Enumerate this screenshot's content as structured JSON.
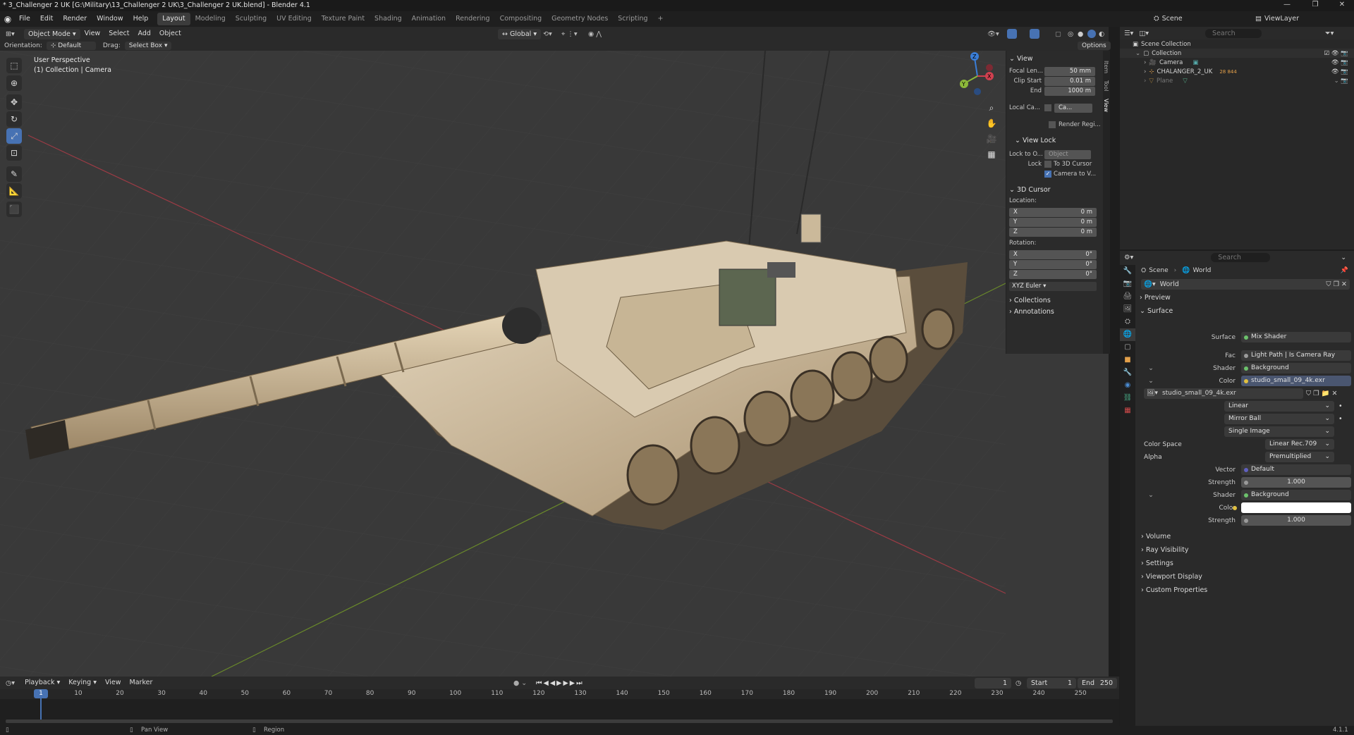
{
  "window": {
    "title": "* 3_Challenger 2 UK [G:\\Military\\13_Challenger 2 UK\\3_Challenger 2 UK.blend] - Blender 4.1",
    "controls": [
      "—",
      "❐",
      "✕"
    ]
  },
  "menu": [
    "File",
    "Edit",
    "Render",
    "Window",
    "Help"
  ],
  "workspaces": [
    "Layout",
    "Modeling",
    "Sculpting",
    "UV Editing",
    "Texture Paint",
    "Shading",
    "Animation",
    "Rendering",
    "Compositing",
    "Geometry Nodes",
    "Scripting"
  ],
  "active_workspace": "Layout",
  "scene_selector": {
    "scene": "Scene",
    "view_layer": "ViewLayer"
  },
  "viewport_header": {
    "mode": "Object Mode",
    "menus": [
      "View",
      "Select",
      "Add",
      "Object"
    ],
    "transform_orientation": "Global",
    "options_label": "Options",
    "orientation_label": "Orientation:",
    "orientation_value": "Default",
    "drag_label": "Drag:",
    "drag_value": "Select Box"
  },
  "viewport": {
    "perspective": "User Perspective",
    "context": "(1) Collection | Camera",
    "gizmo_axes": [
      "X",
      "Y",
      "Z"
    ]
  },
  "npanel": {
    "tabs": [
      "Item",
      "Tool",
      "View"
    ],
    "view_section": "View",
    "focal_length_label": "Focal Len...",
    "focal_length": "50 mm",
    "clip_start_label": "Clip Start",
    "clip_start": "0.01 m",
    "end_label": "End",
    "clip_end": "1000 m",
    "local_camera_label": "Local Ca...",
    "local_camera_value": "Ca...",
    "render_region_label": "Render Regi...",
    "view_lock_section": "View Lock",
    "lock_to_object_label": "Lock to O...",
    "lock_to_object_value": "Object",
    "lock_label": "Lock",
    "to_3d_cursor": "To 3D Cursor",
    "camera_to_view": "Camera to V...",
    "cursor_section": "3D Cursor",
    "location_label": "Location:",
    "loc_x": "0 m",
    "loc_y": "0 m",
    "loc_z": "0 m",
    "rotation_label": "Rotation:",
    "rot_x": "0°",
    "rot_y": "0°",
    "rot_z": "0°",
    "rotation_mode": "XYZ Euler",
    "collections_section": "Collections",
    "annotations_section": "Annotations",
    "axis_x": "X",
    "axis_y": "Y",
    "axis_z": "Z"
  },
  "outliner": {
    "search_placeholder": "Search",
    "root": "Scene Collection",
    "collection": "Collection",
    "items": [
      {
        "name": "Camera",
        "color": "#e3a04a"
      },
      {
        "name": "CHALANGER_2_UK",
        "color": "#e3a04a",
        "badge": "28 844"
      },
      {
        "name": "Plane",
        "color": "#e3a04a"
      }
    ]
  },
  "properties": {
    "search_placeholder": "Search",
    "breadcrumb": [
      "Scene",
      "World"
    ],
    "world_name": "World",
    "sections": {
      "preview": "Preview",
      "surface": "Surface",
      "volume": "Volume",
      "ray_visibility": "Ray Visibility",
      "settings": "Settings",
      "viewport_display": "Viewport Display",
      "custom_properties": "Custom Properties"
    },
    "surface_label": "Surface",
    "surface_value": "Mix Shader",
    "fac_label": "Fac",
    "fac_value": "Light Path | Is Camera Ray",
    "shader1_label": "Shader",
    "shader1_value": "Background",
    "color1_label": "Color",
    "color1_value": "studio_small_09_4k.exr",
    "image_name": "studio_small_09_4k.exr",
    "interp": "Linear",
    "projection": "Mirror Ball",
    "source": "Single Image",
    "color_space_label": "Color Space",
    "color_space_value": "Linear Rec.709",
    "alpha_label": "Alpha",
    "alpha_value": "Premultiplied",
    "vector_label": "Vector",
    "vector_value": "Default",
    "strength1_label": "Strength",
    "strength1_value": "1.000",
    "shader2_label": "Shader",
    "shader2_value": "Background",
    "color2_label": "Color",
    "strength2_label": "Strength",
    "strength2_value": "1.000"
  },
  "timeline": {
    "menus": [
      "Playback",
      "Keying",
      "View",
      "Marker"
    ],
    "current_frame": "1",
    "start_label": "Start",
    "start": "1",
    "end_label": "End",
    "end": "250",
    "ticks": [
      "1",
      "10",
      "20",
      "30",
      "40",
      "50",
      "60",
      "70",
      "80",
      "90",
      "100",
      "110",
      "120",
      "130",
      "140",
      "150",
      "160",
      "170",
      "180",
      "190",
      "200",
      "210",
      "220",
      "230",
      "240",
      "250"
    ]
  },
  "status": {
    "left": "Pan View",
    "middle": "Region",
    "version": "4.1.1"
  },
  "colors": {
    "accent": "#4772b3",
    "x_axis": "#d0404f",
    "y_axis": "#8cb83a",
    "z_axis": "#3a7ed8",
    "tank_body": "#c8b492"
  }
}
